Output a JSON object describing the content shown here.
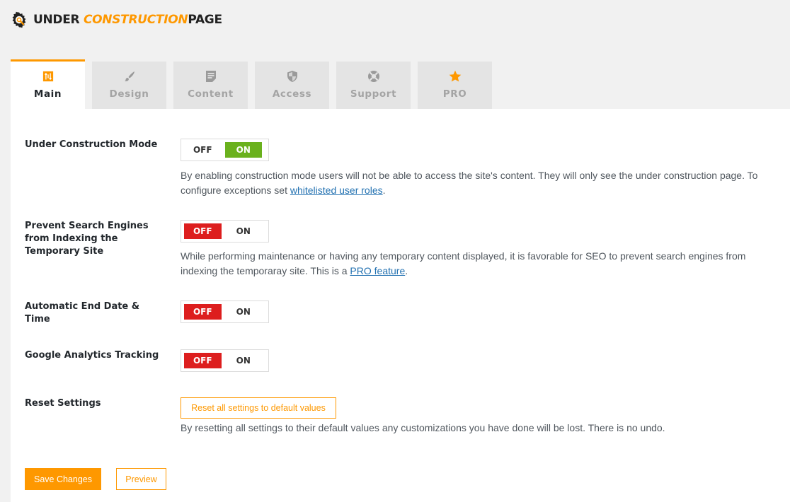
{
  "brand": {
    "part1": "UNDER ",
    "part2": "CONSTRUCTION",
    "part3": "PAGE",
    "accent": "#fe9800"
  },
  "tabs": [
    {
      "label": "Main",
      "icon": "sliders-icon",
      "active": true
    },
    {
      "label": "Design",
      "icon": "brush-icon",
      "active": false
    },
    {
      "label": "Content",
      "icon": "document-icon",
      "active": false
    },
    {
      "label": "Access",
      "icon": "shield-icon",
      "active": false
    },
    {
      "label": "Support",
      "icon": "lifebuoy-icon",
      "active": false
    },
    {
      "label": "PRO",
      "icon": "star-icon",
      "active": false
    }
  ],
  "settings": {
    "construction_mode": {
      "label": "Under Construction Mode",
      "off": "OFF",
      "on": "ON",
      "value": "ON",
      "desc_text": "By enabling construction mode users will not be able to access the site's content. They will only see the under construction page. To configure exceptions set ",
      "desc_link": "whitelisted user roles",
      "desc_end": "."
    },
    "prevent_search": {
      "label": "Prevent Search Engines from Indexing the Temporary Site",
      "off": "OFF",
      "on": "ON",
      "value": "OFF",
      "desc_text": "While performing maintenance or having any temporary content displayed, it is favorable for SEO to prevent search engines from indexing the temporaray site. This is a ",
      "desc_link": "PRO feature",
      "desc_end": "."
    },
    "end_date": {
      "label": "Automatic End Date & Time",
      "off": "OFF",
      "on": "ON",
      "value": "OFF"
    },
    "analytics": {
      "label": "Google Analytics Tracking",
      "off": "OFF",
      "on": "ON",
      "value": "OFF"
    },
    "reset": {
      "label": "Reset Settings",
      "button": "Reset all settings to default values",
      "desc": "By resetting all settings to their default values any customizations you have done will be lost. There is no undo."
    }
  },
  "actions": {
    "save": "Save Changes",
    "preview": "Preview"
  },
  "colors": {
    "off_active": "#dd1e1e",
    "on_active": "#6ab11d",
    "link": "#2271b1"
  }
}
